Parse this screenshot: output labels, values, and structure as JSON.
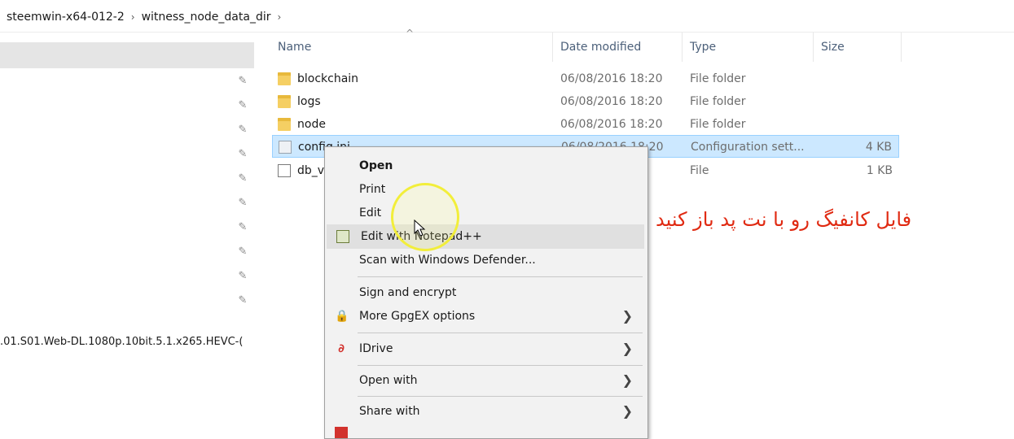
{
  "breadcrumb": {
    "items": [
      "steemwin-x64-012-2",
      "witness_node_data_dir"
    ],
    "separator": "›"
  },
  "nav": {
    "truncated_item": ".01.S01.Web-DL.1080p.10bit.5.1.x265.HEVC-("
  },
  "columns": {
    "name": "Name",
    "date": "Date modified",
    "type": "Type",
    "size": "Size"
  },
  "files": [
    {
      "name": "blockchain",
      "date": "06/08/2016 18:20",
      "type": "File folder",
      "size": "",
      "icon": "folder-icon"
    },
    {
      "name": "logs",
      "date": "06/08/2016 18:20",
      "type": "File folder",
      "size": "",
      "icon": "folder-icon"
    },
    {
      "name": "node",
      "date": "06/08/2016 18:20",
      "type": "File folder",
      "size": "",
      "icon": "folder-icon"
    },
    {
      "name": "config.ini",
      "date": "06/08/2016 18:20",
      "type": "Configuration sett...",
      "size": "4 KB",
      "icon": "config-file-icon"
    },
    {
      "name": "db_v",
      "date": "0",
      "type": "File",
      "size": "1 KB",
      "icon": "file-icon"
    }
  ],
  "context_menu": {
    "open": "Open",
    "print": "Print",
    "edit": "Edit",
    "edit_notepad": "Edit with Notepad++",
    "scan": "Scan with Windows Defender...",
    "sign_encrypt": "Sign and encrypt",
    "more_gpgex": "More GpgEX options",
    "idrive": "IDrive",
    "open_with": "Open with",
    "share_with": "Share with"
  },
  "annotation": "فایل کانفیگ رو با نت پد باز کنید",
  "colors": {
    "selection_bg": "#cce8ff",
    "annotation": "#e02a12",
    "highlight_ring": "#f2ee3a"
  }
}
